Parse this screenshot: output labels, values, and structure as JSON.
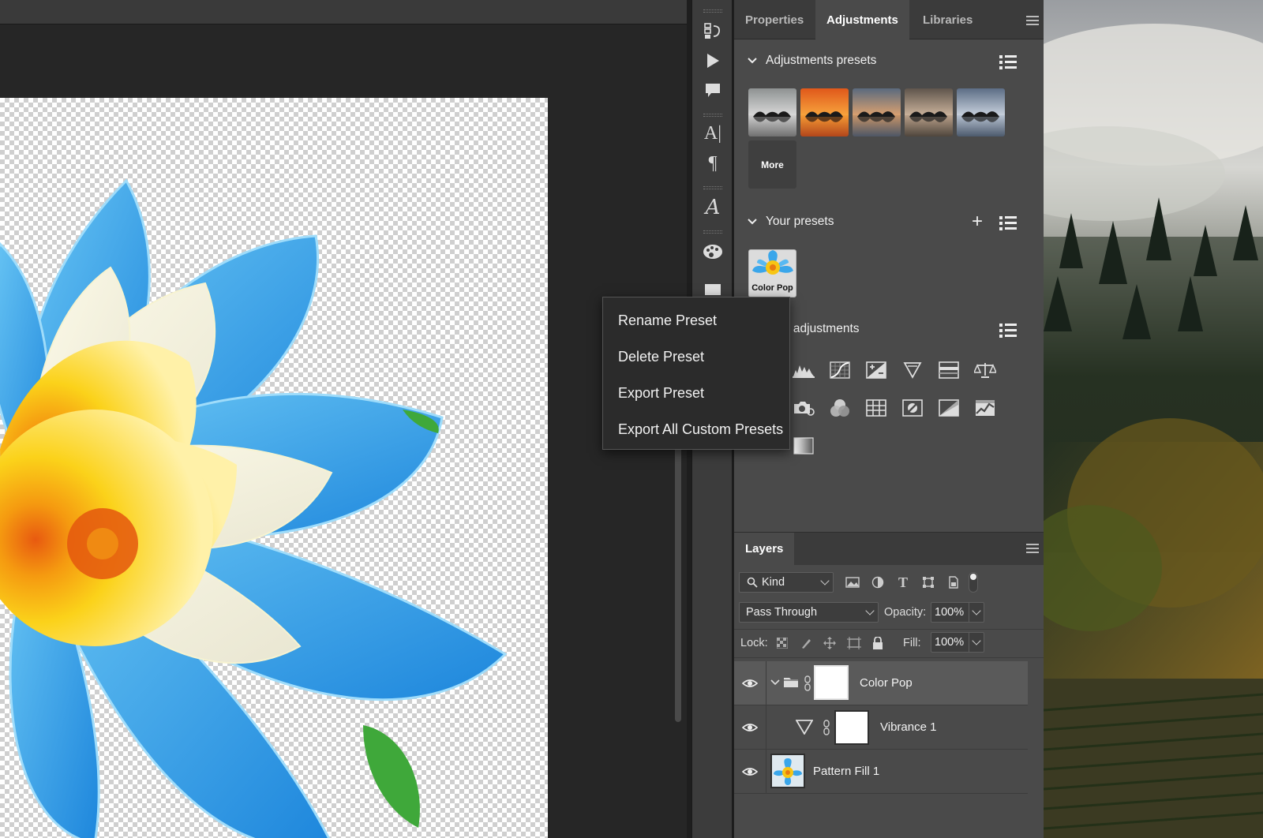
{
  "panel": {
    "tabs": [
      "Properties",
      "Adjustments",
      "Libraries"
    ],
    "active_tab": "Adjustments"
  },
  "adjustments_presets": {
    "title": "Adjustments presets",
    "more_label": "More"
  },
  "your_presets": {
    "title": "Your presets",
    "items": [
      {
        "label": "Color Pop"
      }
    ]
  },
  "single_adjustments": {
    "title_visible": "e adjustments"
  },
  "context_menu": {
    "items": [
      "Rename Preset",
      "Delete Preset",
      "Export Preset",
      "Export All Custom Presets"
    ]
  },
  "layers": {
    "tab": "Layers",
    "filter_kind": "Kind",
    "blend_mode": "Pass Through",
    "opacity_label": "Opacity:",
    "opacity_value": "100%",
    "lock_label": "Lock:",
    "fill_label": "Fill:",
    "fill_value": "100%",
    "rows": [
      {
        "name": "Color Pop"
      },
      {
        "name": "Vibrance 1"
      },
      {
        "name": "Pattern Fill 1"
      }
    ]
  },
  "colors": {
    "accent_flower_blue": "#3aa6ea",
    "accent_flower_yellow": "#f7c514",
    "panel_bg": "#4a4a4a"
  }
}
